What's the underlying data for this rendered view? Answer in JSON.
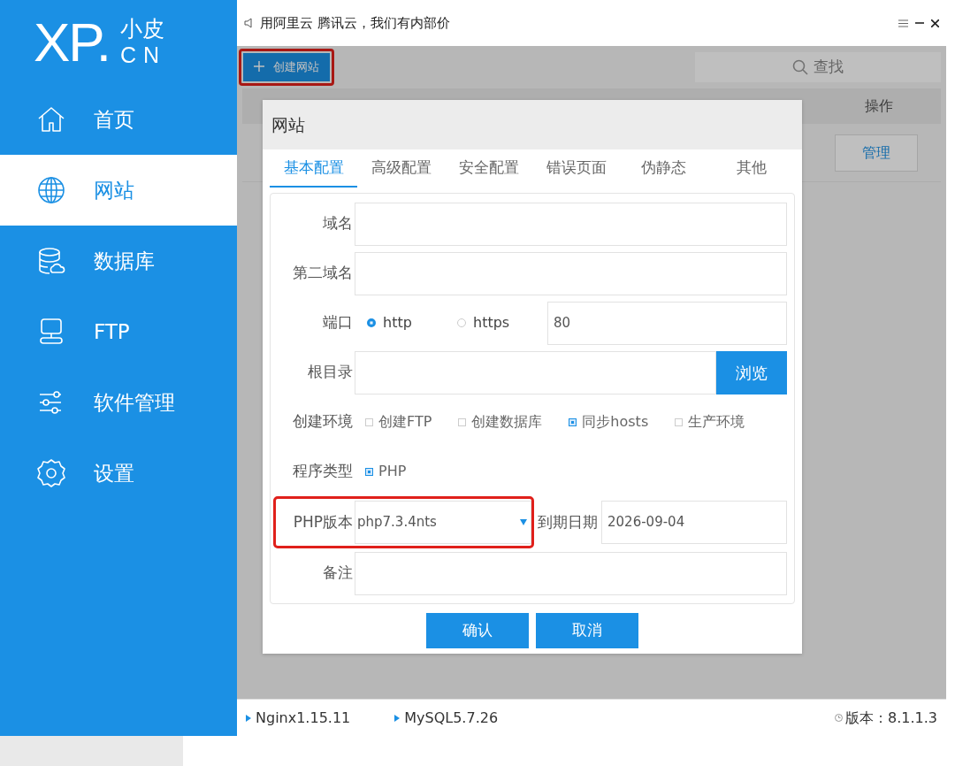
{
  "logo": {
    "letters": "XP.",
    "top": "小皮",
    "bottom": "CN"
  },
  "sidebar": {
    "items": [
      {
        "kind": "home",
        "label": "首页",
        "selected": false
      },
      {
        "kind": "globe",
        "label": "网站",
        "selected": true
      },
      {
        "kind": "database",
        "label": "数据库",
        "selected": false
      },
      {
        "kind": "ftp",
        "label": "FTP",
        "selected": false
      },
      {
        "kind": "sliders",
        "label": "软件管理",
        "selected": false
      },
      {
        "kind": "gear",
        "label": "设置",
        "selected": false
      }
    ]
  },
  "top_bar": {
    "notice": "用阿里云 腾讯云，我们有内部价"
  },
  "toolbar": {
    "create_button": {
      "label": "创建网站",
      "highlighted": true
    },
    "search": {
      "placeholder": "查找"
    }
  },
  "table": {
    "columns": [
      "操作"
    ],
    "rows": [
      {
        "action": "管理"
      }
    ]
  },
  "dialog": {
    "title": "网站",
    "tabs": [
      {
        "label": "基本配置",
        "selected": true
      },
      {
        "label": "高级配置",
        "selected": false
      },
      {
        "label": "安全配置",
        "selected": false
      },
      {
        "label": "错误页面",
        "selected": false
      },
      {
        "label": "伪静态",
        "selected": false
      },
      {
        "label": "其他",
        "selected": false
      }
    ],
    "rows": [
      {
        "kind": "input",
        "label": "域名"
      },
      {
        "kind": "input",
        "label": "第二域名"
      },
      {
        "kind": "port",
        "label": "端口",
        "options": [
          {
            "label": "http",
            "selected": true
          },
          {
            "label": "https",
            "selected": false
          }
        ],
        "value": "80"
      },
      {
        "kind": "browse",
        "label": "根目录",
        "button": "浏览"
      },
      {
        "kind": "checks",
        "label": "创建环境",
        "options": [
          {
            "label": "创建FTP",
            "checked": false
          },
          {
            "label": "创建数据库",
            "checked": false
          },
          {
            "label": "同步hosts",
            "checked": true
          },
          {
            "label": "生产环境",
            "checked": false
          }
        ]
      },
      {
        "kind": "checks",
        "label": "程序类型",
        "options": [
          {
            "label": "PHP",
            "checked": true
          }
        ]
      },
      {
        "kind": "select_date",
        "label": "PHP版本",
        "value": "php7.3.4nts",
        "highlighted": true,
        "date_label": "到期日期",
        "date_value": "2026-09-04"
      },
      {
        "kind": "input",
        "label": "备注"
      }
    ],
    "buttons": [
      {
        "label": "确认"
      },
      {
        "label": "取消"
      }
    ]
  },
  "status_bar": {
    "services": [
      {
        "label": "Nginx1.15.11"
      },
      {
        "label": "MySQL5.7.26"
      }
    ],
    "version": "版本：8.1.1.3"
  }
}
